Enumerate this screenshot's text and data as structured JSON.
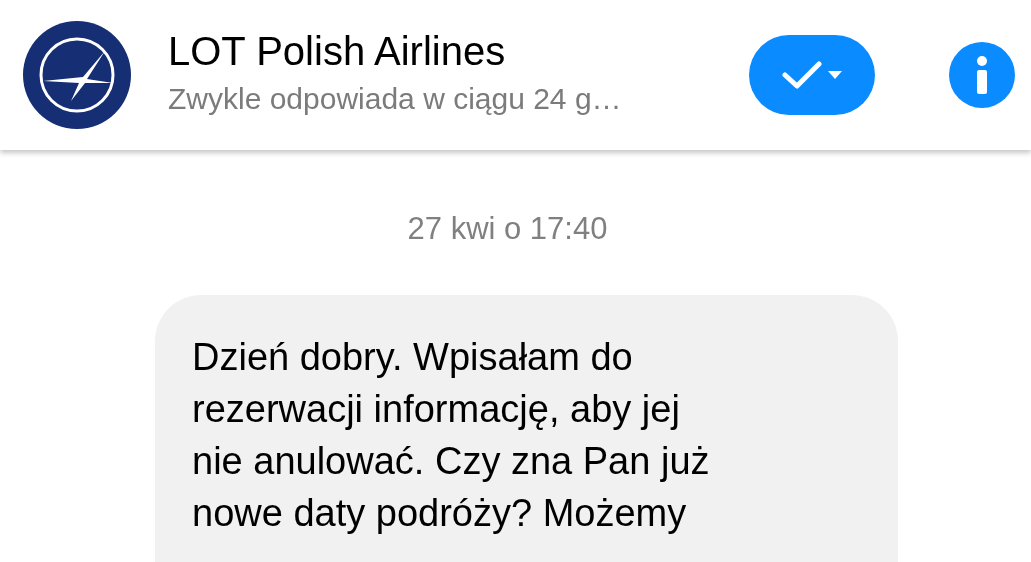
{
  "header": {
    "title": "LOT Polish Airlines",
    "subtitle": "Zwykle odpowiada w ciągu 24 g…"
  },
  "conversation": {
    "timestamp": "27 kwi o 17:40",
    "messages": [
      {
        "kind": "incoming",
        "text": "Dzień dobry. Wpisałam do\nrezerwacji informację, aby jej\nnie anulować. Czy zna Pan już\nnowe daty podróży? Możemy"
      }
    ]
  }
}
